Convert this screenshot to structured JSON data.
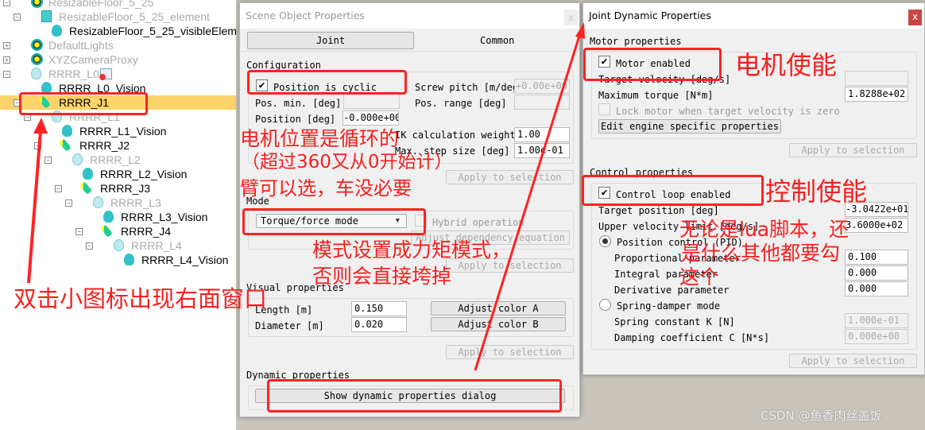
{
  "tree": {
    "items": [
      {
        "label": "ResizableFloor_5_25",
        "type": "model",
        "gray": true,
        "expander": "-"
      },
      {
        "label": "ResizableFloor_5_25_element",
        "type": "cube",
        "gray": true,
        "expander": "-"
      },
      {
        "label": "ResizableFloor_5_25_visibleElement",
        "type": "shape",
        "gray": false
      },
      {
        "label": "DefaultLights",
        "type": "model",
        "gray": true,
        "expander": "+"
      },
      {
        "label": "XYZCameraProxy",
        "type": "model",
        "gray": true,
        "expander": "+"
      },
      {
        "label": "RRRR_L0",
        "type": "dummy",
        "gray": true,
        "expander": "-",
        "script": true
      },
      {
        "label": "RRRR_L0_Vision",
        "type": "shape",
        "gray": false
      },
      {
        "label": "RRRR_J1",
        "type": "joint",
        "gray": false,
        "expander": "-",
        "selected": true
      },
      {
        "label": "RRRR_L1",
        "type": "dummy",
        "gray": true,
        "expander": "-"
      },
      {
        "label": "RRRR_L1_Vision",
        "type": "shape",
        "gray": false
      },
      {
        "label": "RRRR_J2",
        "type": "joint",
        "gray": false,
        "expander": "-"
      },
      {
        "label": "RRRR_L2",
        "type": "dummy",
        "gray": true,
        "expander": "-"
      },
      {
        "label": "RRRR_L2_Vision",
        "type": "shape",
        "gray": false
      },
      {
        "label": "RRRR_J3",
        "type": "joint",
        "gray": false,
        "expander": "-"
      },
      {
        "label": "RRRR_L3",
        "type": "dummy",
        "gray": true,
        "expander": "-"
      },
      {
        "label": "RRRR_L3_Vision",
        "type": "shape",
        "gray": false
      },
      {
        "label": "RRRR_J4",
        "type": "joint",
        "gray": false,
        "expander": "-"
      },
      {
        "label": "RRRR_L4",
        "type": "dummy",
        "gray": true,
        "expander": "-"
      },
      {
        "label": "RRRR_L4_Vision",
        "type": "shape",
        "gray": false
      }
    ]
  },
  "scene_dialog": {
    "title": "Scene Object Properties",
    "close": "x",
    "tabs": [
      "Joint",
      "Common"
    ],
    "configuration": {
      "label": "Configuration",
      "cyclic_label": "Position is cyclic",
      "cyclic": true,
      "pos_min_label": "Pos. min. [deg]",
      "pos_min": "",
      "position_label": "Position [deg]",
      "position": "-0.000e+00",
      "screw_label": "Screw pitch [m/deg",
      "screw": "+0.00e+00",
      "pos_range_label": "Pos. range [deg]",
      "pos_range": "",
      "ik_label": "IK calculation weight",
      "ik": "1.00",
      "step_label": "Max. step size [deg]",
      "step": "1.00e-01"
    },
    "apply": "Apply to selection",
    "mode": {
      "label": "Mode",
      "selected": "Torque/force mode",
      "hybrid_label": "Hybrid operation",
      "dependency": "Adjust dependency equation"
    },
    "visual": {
      "label": "Visual properties",
      "length_label": "Length [m]",
      "length": "0.150",
      "diameter_label": "Diameter [m]",
      "diameter": "0.020",
      "color_a": "Adjust color A",
      "color_b": "Adjust color B"
    },
    "dynamic": {
      "label": "Dynamic properties",
      "button": "Show dynamic properties dialog"
    }
  },
  "dyn_dialog": {
    "title": "Joint Dynamic Properties",
    "close": "x",
    "motor": {
      "label": "Motor properties",
      "enabled_label": "Motor enabled",
      "enabled": true,
      "target_vel_label": "Target velocity [deg/s]",
      "target_vel": "",
      "max_torque_label": "Maximum torque [N*m]",
      "max_torque": "1.8288e+02",
      "lock_label": "Lock motor when target velocity is zero",
      "edit": "Edit engine specific properties"
    },
    "apply": "Apply to selection",
    "control": {
      "label": "Control properties",
      "loop_label": "Control loop enabled",
      "loop": true,
      "target_pos_label": "Target position [deg]",
      "target_pos": "-3.0422e+01",
      "upper_vel_label": "Upper velocity limit [deg/s]",
      "upper_vel": "3.6000e+02",
      "pid_label": "Position control (PID)",
      "p_label": "Proportional parameter",
      "p": "0.100",
      "i_label": "Integral parameter",
      "i": "0.000",
      "d_label": "Derivative parameter",
      "d": "0.000",
      "spring_label": "Spring-damper mode",
      "k_label": "Spring constant K [N]",
      "k": "1.000e-01",
      "c_label": "Damping coefficient C [N*s]",
      "c": "0.000e+00"
    }
  },
  "annotations": {
    "cyclic": [
      "电机位置是循环的",
      "（超过360又从0开始计）",
      "臂可以选，车没必要"
    ],
    "mode": [
      "模式设置成力矩模式，",
      "否则会直接垮掉"
    ],
    "dblclick": "双击小图标出现右面窗口",
    "motor": "电机使能",
    "control": "控制使能",
    "lua": [
      "无论是lua脚本，还",
      "是什么其他都要勾",
      "这个"
    ]
  },
  "watermark": "CSDN @鱼香肉丝盖饭",
  "colors": {
    "annotation": "#f52020",
    "selection": "#fdd36b",
    "close_button": "#c94545"
  }
}
